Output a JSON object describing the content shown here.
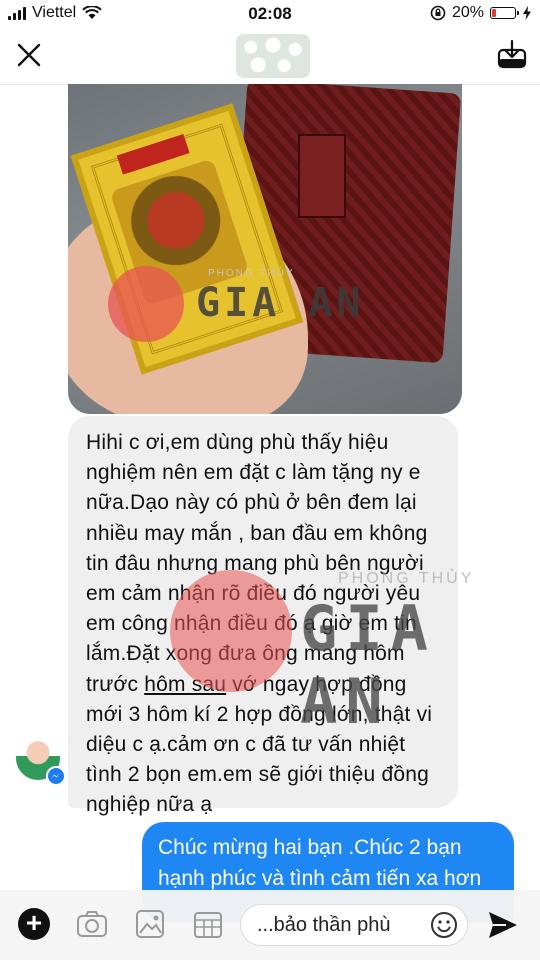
{
  "status_bar": {
    "carrier": "Viettel",
    "time": "02:08",
    "battery_percent": "20%",
    "battery_level": 0.2
  },
  "header": {
    "close_icon": "close-icon",
    "download_icon": "download-icon"
  },
  "photo": {
    "watermark_small": "PHONG THỦY",
    "watermark_brand": "GIA AN"
  },
  "messages": {
    "received_lines": [
      "Hihi c ơi,em dùng phù thấy hiệu",
      "nghiệm nên em đặt c làm tặng ny e",
      "nữa.Dạo này có phù ở bên đem lại",
      "nhiều may mắn , ban đầu em không",
      "tin đâu nhưng mang phù bên người",
      "em cảm nhận rõ điều đó người yêu",
      "em công nhận điều đó ạ giờ em tin",
      "lắm.Đặt xong đưa ông mang hôm"
    ],
    "received_line9_a": "trước ",
    "received_line9_underlined": "hôm sau",
    "received_line9_b": " vớ ngay hợp đồng",
    "received_lines_end": [
      "mới 3 hôm kí 2 hợp đồng lớn, thật vi",
      "diệu c ạ.cảm ơn c đã tư vấn nhiệt",
      "tình 2 bọn em.em sẽ giới thiệu đồng",
      "nghiệp nữa ạ"
    ],
    "sent_lines": [
      "Chúc mừng hai bạn .Chúc 2 bạn",
      "hạnh phúc và tình cảm tiến xa hơn"
    ]
  },
  "watermark": {
    "small": "PHONG THỦY",
    "brand": "GIA AN"
  },
  "composer": {
    "input_value": "...bảo thần phù",
    "icons": [
      "plus-icon",
      "camera-icon",
      "image-icon",
      "sticker-icon",
      "emoji-icon",
      "send-icon"
    ]
  },
  "colors": {
    "sent_bubble": "#1f87f4",
    "received_bubble": "#efefef",
    "battery_low": "#e23b2d"
  }
}
